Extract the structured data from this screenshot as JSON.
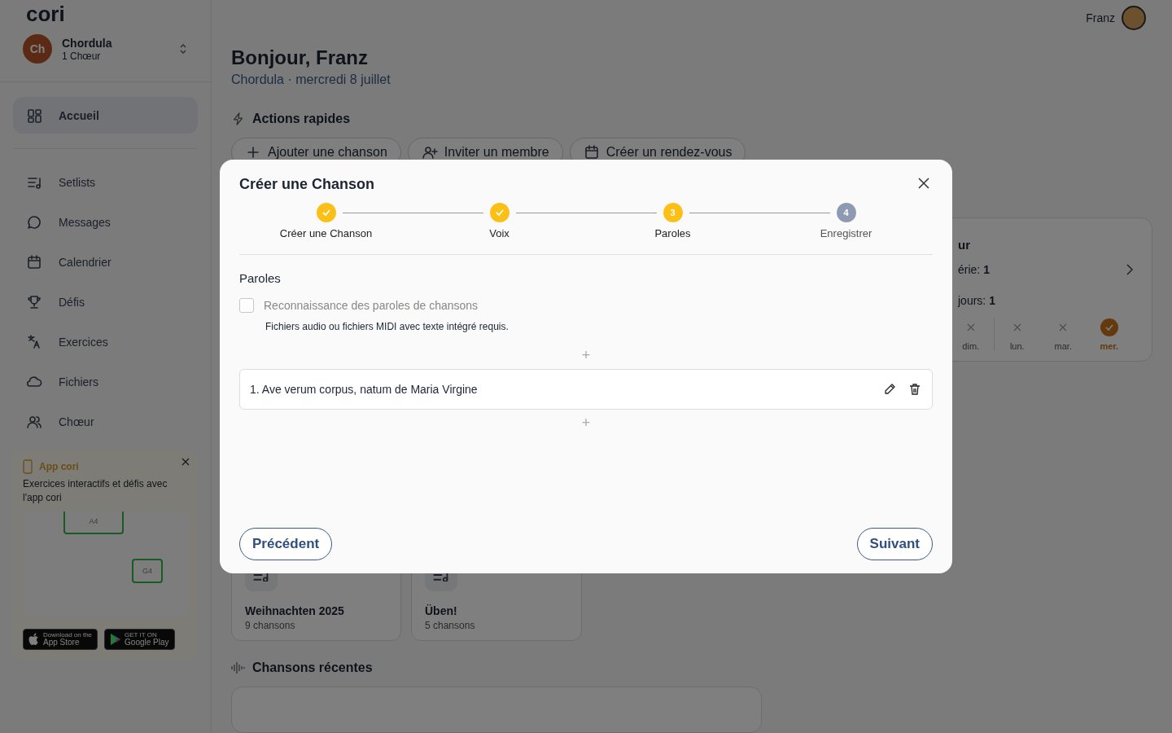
{
  "sidebar": {
    "logo": "cori",
    "choir": {
      "initials": "Ch",
      "name": "Chordula",
      "subtitle": "1 Chœur"
    },
    "items": [
      {
        "kind": "home",
        "label": "Accueil",
        "selected": true
      },
      {
        "kind": "setlists",
        "label": "Setlists",
        "selected": false
      },
      {
        "kind": "messages",
        "label": "Messages",
        "selected": false
      },
      {
        "kind": "calendar",
        "label": "Calendrier",
        "selected": false
      },
      {
        "kind": "challenges",
        "label": "Défis",
        "selected": false
      },
      {
        "kind": "exercises",
        "label": "Exercices",
        "selected": false
      },
      {
        "kind": "files",
        "label": "Fichiers",
        "selected": false
      },
      {
        "kind": "choir",
        "label": "Chœur",
        "selected": false
      }
    ],
    "promo": {
      "title": "App cori",
      "text": "Exercices interactifs et défis avec l'app cori",
      "notes": [
        "A4",
        "G4"
      ],
      "stores": [
        {
          "kind": "apple",
          "small": "Download on the",
          "big": "App Store"
        },
        {
          "kind": "google",
          "small": "GET IT ON",
          "big": "Google Play"
        }
      ]
    }
  },
  "header": {
    "user": "Franz"
  },
  "main": {
    "greeting": "Bonjour, Franz",
    "subtitle": "Chordula · mercredi 8 juillet",
    "quick_title": "Actions rapides",
    "quick_actions": [
      {
        "kind": "plus",
        "label": "Ajouter une chanson"
      },
      {
        "kind": "invite",
        "label": "Inviter un membre"
      },
      {
        "kind": "calendar",
        "label": "Créer un rendez-vous"
      }
    ],
    "streak": {
      "title": "ur",
      "lines": [
        "érie: **1**",
        "jours: **1**"
      ],
      "days": [
        {
          "label": "dim.",
          "done": false
        },
        {
          "label": "lun.",
          "done": false
        },
        {
          "label": "mar.",
          "done": false
        },
        {
          "label": "mer.",
          "done": true
        }
      ]
    },
    "setlists": [
      {
        "name": "Weihnachten 2025",
        "count": "9 chansons"
      },
      {
        "name": "Üben!",
        "count": "5 chansons"
      }
    ],
    "recent_title": "Chansons récentes"
  },
  "modal": {
    "title": "Créer une Chanson",
    "steps": [
      {
        "label": "Créer une Chanson",
        "kind": "done"
      },
      {
        "label": "Voix",
        "kind": "done"
      },
      {
        "label": "Paroles",
        "number": "3",
        "kind": "current"
      },
      {
        "label": "Enregistrer",
        "number": "4",
        "kind": "pending"
      }
    ],
    "section": "Paroles",
    "checkbox": {
      "label": "Reconnaissance des paroles de chansons",
      "checked": false,
      "disabled": true
    },
    "hint": "Fichiers audio ou fichiers MIDI avec texte intégré requis.",
    "add_symbol": "+",
    "lyrics": [
      {
        "text": "1. Ave verum corpus, natum de Maria Virgine"
      }
    ],
    "prev": "Précédent",
    "next": "Suivant"
  }
}
